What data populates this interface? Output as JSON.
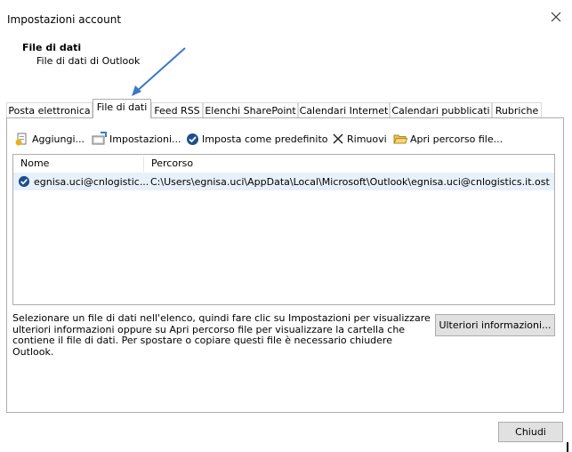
{
  "window": {
    "title": "Impostazioni account"
  },
  "header": {
    "title": "File di dati",
    "subtitle": "File di dati di Outlook"
  },
  "tabs": [
    {
      "label": "Posta elettronica"
    },
    {
      "label": "File di dati",
      "selected": true
    },
    {
      "label": "Feed RSS"
    },
    {
      "label": "Elenchi SharePoint"
    },
    {
      "label": "Calendari Internet"
    },
    {
      "label": "Calendari pubblicati"
    },
    {
      "label": "Rubriche"
    }
  ],
  "toolbar": {
    "add": "Aggiungi...",
    "settings": "Impostazioni...",
    "set_default": "Imposta come predefinito",
    "remove": "Rimuovi",
    "open_location": "Apri percorso file..."
  },
  "list": {
    "columns": [
      "Nome",
      "Percorso"
    ],
    "rows": [
      {
        "name": "egnisa.uci@cnlogistic...",
        "path": "C:\\Users\\egnisa.uci\\AppData\\Local\\Microsoft\\Outlook\\egnisa.uci@cnlogistics.it.ost",
        "default": true
      }
    ]
  },
  "description": "Selezionare un file di dati nell'elenco, quindi fare clic su Impostazioni per visualizzare ulteriori informazioni oppure su Apri percorso file per visualizzare la cartella che contiene il file di dati. Per spostare o copiare questi file è necessario chiudere Outlook.",
  "buttons": {
    "more_info": "Ulteriori informazioni...",
    "close": "Chiudi"
  },
  "colors": {
    "annotation_arrow": "#3a78c9",
    "selection": "#e8f0fa",
    "default_check": "#1e4e8c"
  },
  "icons": [
    "close-icon",
    "add-file-icon",
    "settings-icon",
    "default-check-icon",
    "remove-x-icon",
    "folder-icon",
    "arrow-annotation"
  ]
}
